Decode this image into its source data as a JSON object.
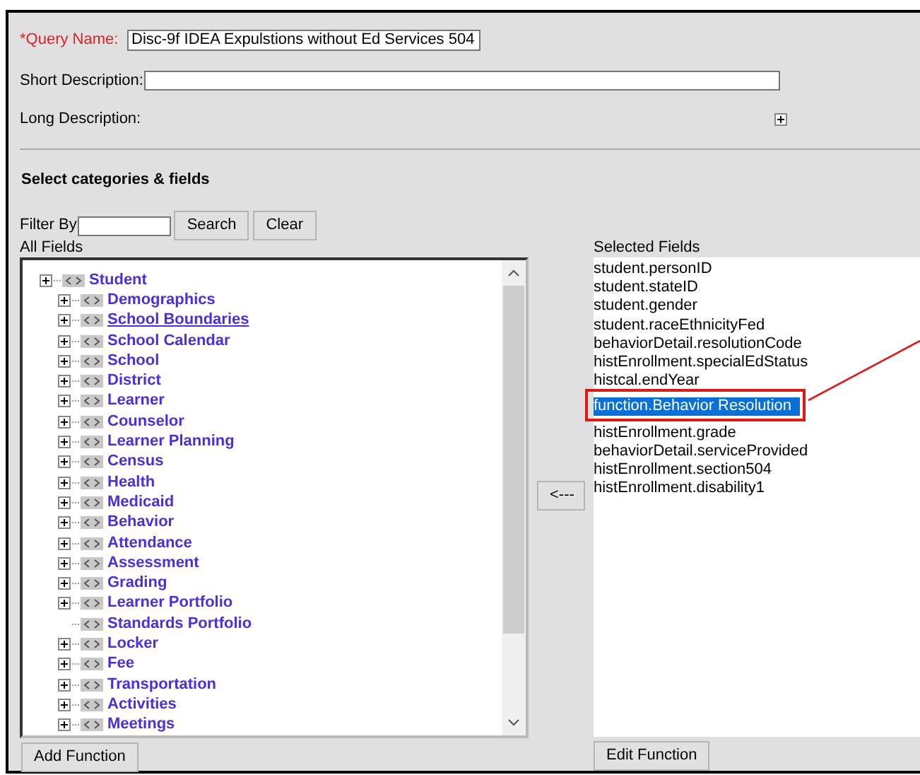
{
  "query_name": {
    "label": "*Query Name:",
    "value": "Disc-9f IDEA Expulstions without Ed Services 504"
  },
  "short_description": {
    "label": "Short Description:"
  },
  "long_description": {
    "label": "Long Description:",
    "expanded": false
  },
  "section_title": "Select categories & fields",
  "filter": {
    "label": "Filter By",
    "buttons": [
      "Search",
      "Clear"
    ]
  },
  "all_fields": {
    "label": "All Fields",
    "tree": [
      {
        "label": "Student",
        "expandable": true,
        "hovered": false,
        "children": [
          {
            "label": "Demographics",
            "expandable": true,
            "hovered": false
          },
          {
            "label": "School Boundaries",
            "expandable": true,
            "hovered": true
          },
          {
            "label": "School Calendar",
            "expandable": true,
            "hovered": false
          },
          {
            "label": "School",
            "expandable": true,
            "hovered": false
          },
          {
            "label": "District",
            "expandable": true,
            "hovered": false
          },
          {
            "label": "Learner",
            "expandable": true,
            "hovered": false
          },
          {
            "label": "Counselor",
            "expandable": true,
            "hovered": false
          },
          {
            "label": "Learner Planning",
            "expandable": true,
            "hovered": false
          },
          {
            "label": "Census",
            "expandable": true,
            "hovered": false
          },
          {
            "label": "Health",
            "expandable": true,
            "hovered": false
          },
          {
            "label": "Medicaid",
            "expandable": true,
            "hovered": false
          },
          {
            "label": "Behavior",
            "expandable": true,
            "hovered": false
          },
          {
            "label": "Attendance",
            "expandable": true,
            "hovered": false
          },
          {
            "label": "Assessment",
            "expandable": true,
            "hovered": false
          },
          {
            "label": "Grading",
            "expandable": true,
            "hovered": false
          },
          {
            "label": "Learner Portfolio",
            "expandable": true,
            "hovered": false
          },
          {
            "label": "Standards Portfolio",
            "expandable": false,
            "hovered": false
          },
          {
            "label": "Locker",
            "expandable": true,
            "hovered": false
          },
          {
            "label": "Fee",
            "expandable": true,
            "hovered": false
          },
          {
            "label": "Transportation",
            "expandable": true,
            "hovered": false
          },
          {
            "label": "Activities",
            "expandable": true,
            "hovered": false
          },
          {
            "label": "Meetings",
            "expandable": true,
            "hovered": false
          }
        ]
      }
    ],
    "button": "Add Function"
  },
  "move_button": "<---",
  "selected_fields": {
    "label": "Selected Fields",
    "items": [
      {
        "label": "student.personID",
        "selected": false
      },
      {
        "label": "student.stateID",
        "selected": false
      },
      {
        "label": "student.gender",
        "selected": false
      },
      {
        "label": "student.raceEthnicityFed",
        "selected": false
      },
      {
        "label": "behaviorDetail.resolutionCode",
        "selected": false
      },
      {
        "label": "histEnrollment.specialEdStatus",
        "selected": false
      },
      {
        "label": "histcal.endYear",
        "selected": false
      },
      {
        "label": "function.Behavior Resolution",
        "selected": true
      },
      {
        "label": "histEnrollment.grade",
        "selected": false
      },
      {
        "label": "behaviorDetail.serviceProvided",
        "selected": false
      },
      {
        "label": "histEnrollment.section504",
        "selected": false
      },
      {
        "label": "histEnrollment.disability1",
        "selected": false
      }
    ],
    "button": "Edit Function"
  }
}
